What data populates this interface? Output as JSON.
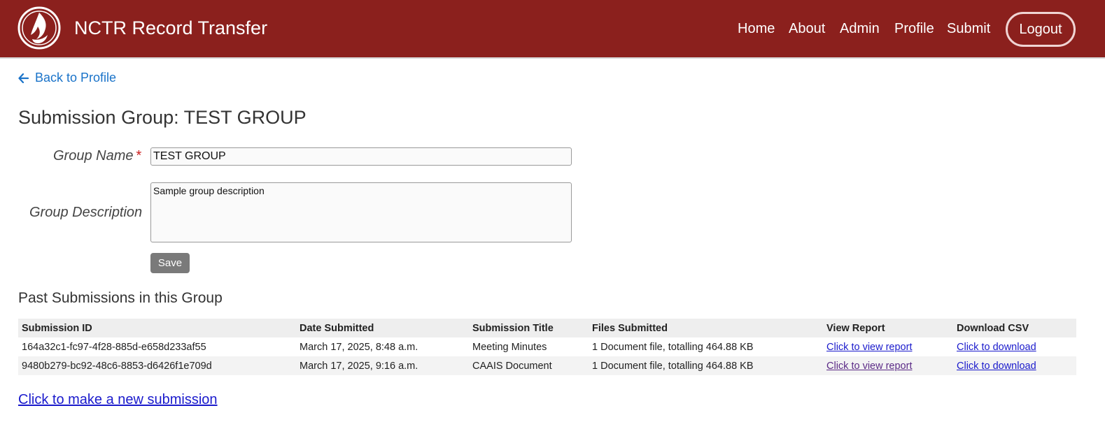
{
  "header": {
    "site_title": "NCTR Record Transfer",
    "logo_icon": "flame-feather-logo-icon",
    "nav": [
      {
        "label": "Home"
      },
      {
        "label": "About"
      },
      {
        "label": "Admin"
      },
      {
        "label": "Profile"
      },
      {
        "label": "Submit"
      }
    ],
    "logout_label": "Logout",
    "bg_color": "#8b201d"
  },
  "back_link": {
    "label": "Back to Profile",
    "icon": "arrow-left-icon"
  },
  "page_title": "Submission Group: TEST GROUP",
  "form": {
    "group_name_label": "Group Name",
    "required_mark": "*",
    "group_name_value": "TEST GROUP",
    "group_description_label": "Group Description",
    "group_description_value": "Sample group description",
    "save_label": "Save"
  },
  "past_submissions": {
    "title": "Past Submissions in this Group",
    "columns": [
      "Submission ID",
      "Date Submitted",
      "Submission Title",
      "Files Submitted",
      "View Report",
      "Download CSV"
    ],
    "rows": [
      {
        "id": "164a32c1-fc97-4f28-885d-e658d233af55",
        "date": "March 17, 2025, 8:48 a.m.",
        "title": "Meeting Minutes",
        "files": "1 Document file, totalling 464.88 KB",
        "report_link": "Click to view report",
        "csv_link": "Click to download"
      },
      {
        "id": "9480b279-bc92-48c6-8853-d6426f1e709d",
        "date": "March 17, 2025, 9:16 a.m.",
        "title": "CAAIS Document",
        "files": "1 Document file, totalling 464.88 KB",
        "report_link": "Click to view report",
        "csv_link": "Click to download"
      }
    ]
  },
  "new_submission_link": "Click to make a new submission"
}
